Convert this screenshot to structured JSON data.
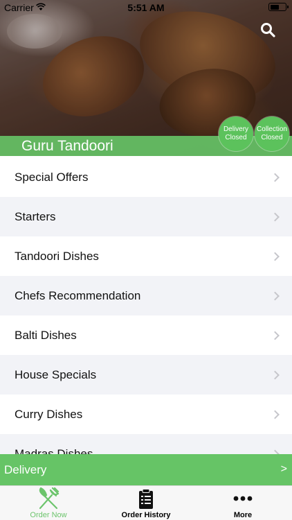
{
  "status_bar": {
    "carrier": "Carrier",
    "time": "5:51 AM"
  },
  "header": {
    "restaurant_name": "Guru Tandoori",
    "delivery_status": {
      "line1": "Delivery",
      "line2": "Closed"
    },
    "collection_status": {
      "line1": "Collection",
      "line2": "Closed"
    },
    "search_icon": "search-icon"
  },
  "menu": {
    "items": [
      {
        "label": "Special Offers"
      },
      {
        "label": "Starters"
      },
      {
        "label": "Tandoori Dishes"
      },
      {
        "label": "Chefs Recommendation"
      },
      {
        "label": "Balti Dishes"
      },
      {
        "label": "House Specials"
      },
      {
        "label": "Curry Dishes"
      },
      {
        "label": "Madras Dishes"
      }
    ]
  },
  "delivery_bar": {
    "label": "Delivery",
    "arrow": ">"
  },
  "tab_bar": {
    "tabs": [
      {
        "label": "Order Now",
        "icon": "fork-knife-icon",
        "active": true
      },
      {
        "label": "Order History",
        "icon": "clipboard-icon",
        "active": false
      },
      {
        "label": "More",
        "icon": "more-dots-icon",
        "active": false
      }
    ]
  },
  "colors": {
    "accent": "#66c466",
    "row_alt": "#f2f3f7"
  }
}
